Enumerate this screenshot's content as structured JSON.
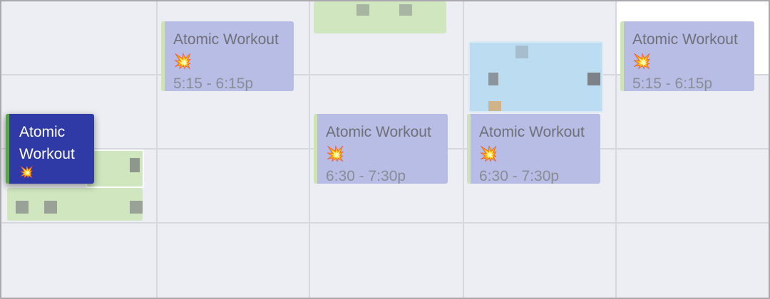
{
  "events": [
    {
      "title": "Atomic Workout",
      "emoji": "💥",
      "time": "5:15 - 6:15p"
    },
    {
      "title": "Atomic Workout",
      "emoji": "💥",
      "time": "5:15 - 6:15p"
    },
    {
      "title": "Atomic Workout",
      "emoji": "💥",
      "time": "6:30 - 7:30p"
    },
    {
      "title": "Atomic Workout",
      "emoji": "💥",
      "time": "6:30 - 7:30p"
    }
  ],
  "selected_event": {
    "title": "Atomic Workout",
    "emoji": "💥"
  },
  "colors": {
    "event_bg": "#b7bde4",
    "selected_bg": "#2f3aa6",
    "selected_accent": "#5ba34f",
    "grid_bg": "#eceef3"
  }
}
